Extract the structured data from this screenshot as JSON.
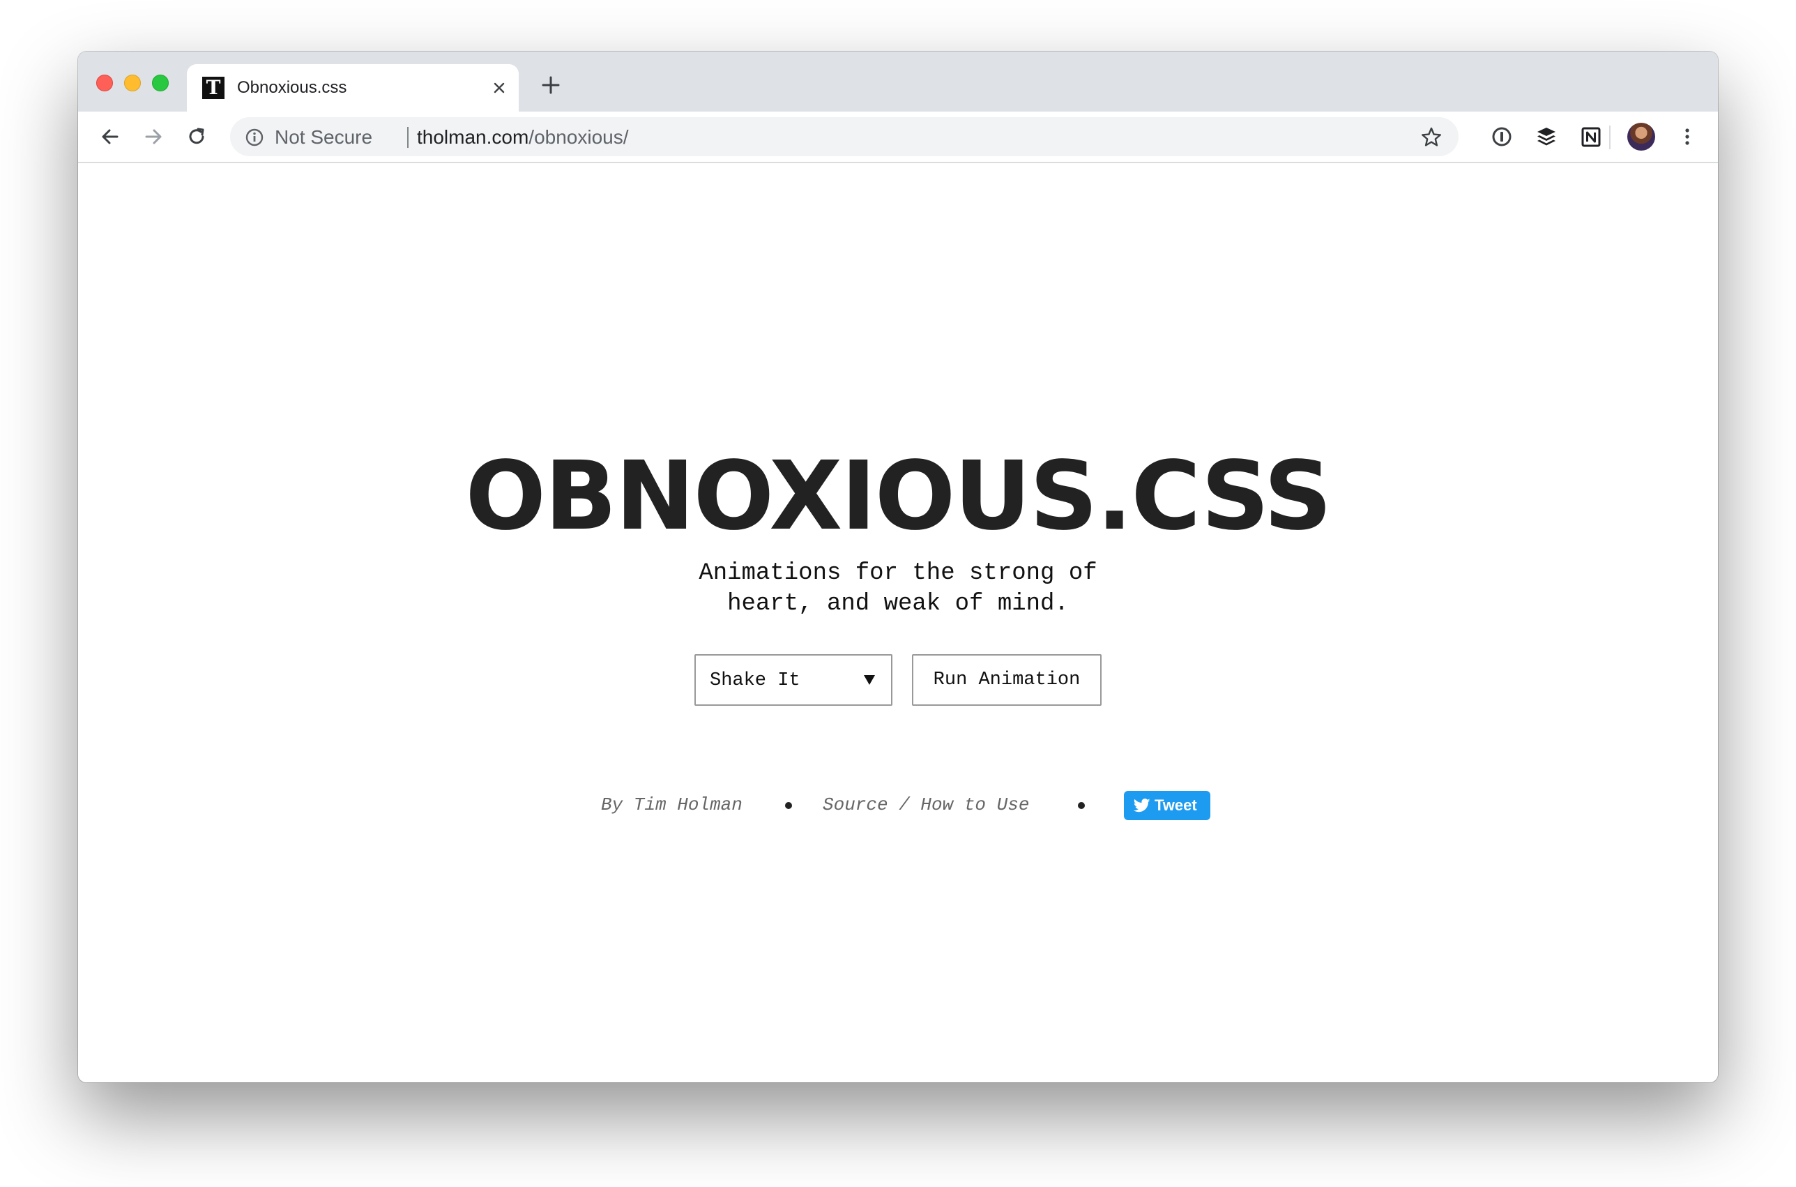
{
  "browser": {
    "tab": {
      "favicon_letter": "T",
      "title": "Obnoxious.css"
    },
    "address_bar": {
      "security_label": "Not Secure",
      "url_host": "tholman.com",
      "url_path": "/obnoxious/"
    },
    "icons": {
      "back": "back-arrow-icon",
      "forward": "forward-arrow-icon",
      "reload": "reload-icon",
      "info": "info-icon",
      "bookmark": "star-icon",
      "extensions": [
        "1password-icon",
        "buffer-icon",
        "notion-icon"
      ],
      "menu": "kebab-menu-icon"
    }
  },
  "page": {
    "title": "OBNOXIOUS.CSS",
    "tagline_line1": "Animations for the strong of",
    "tagline_line2": "heart, and weak of mind.",
    "animation_select": {
      "selected": "Shake It"
    },
    "run_button_label": "Run Animation",
    "footer": {
      "author": "By Tim Holman",
      "source_link": "Source / How to Use",
      "tweet_label": "Tweet"
    }
  },
  "colors": {
    "tabstrip": "#dee1e6",
    "title_text": "#222222",
    "tweet_button": "#1d9bf0",
    "traffic_red": "#fe5f57",
    "traffic_yellow": "#febc2e",
    "traffic_green": "#28c840"
  }
}
